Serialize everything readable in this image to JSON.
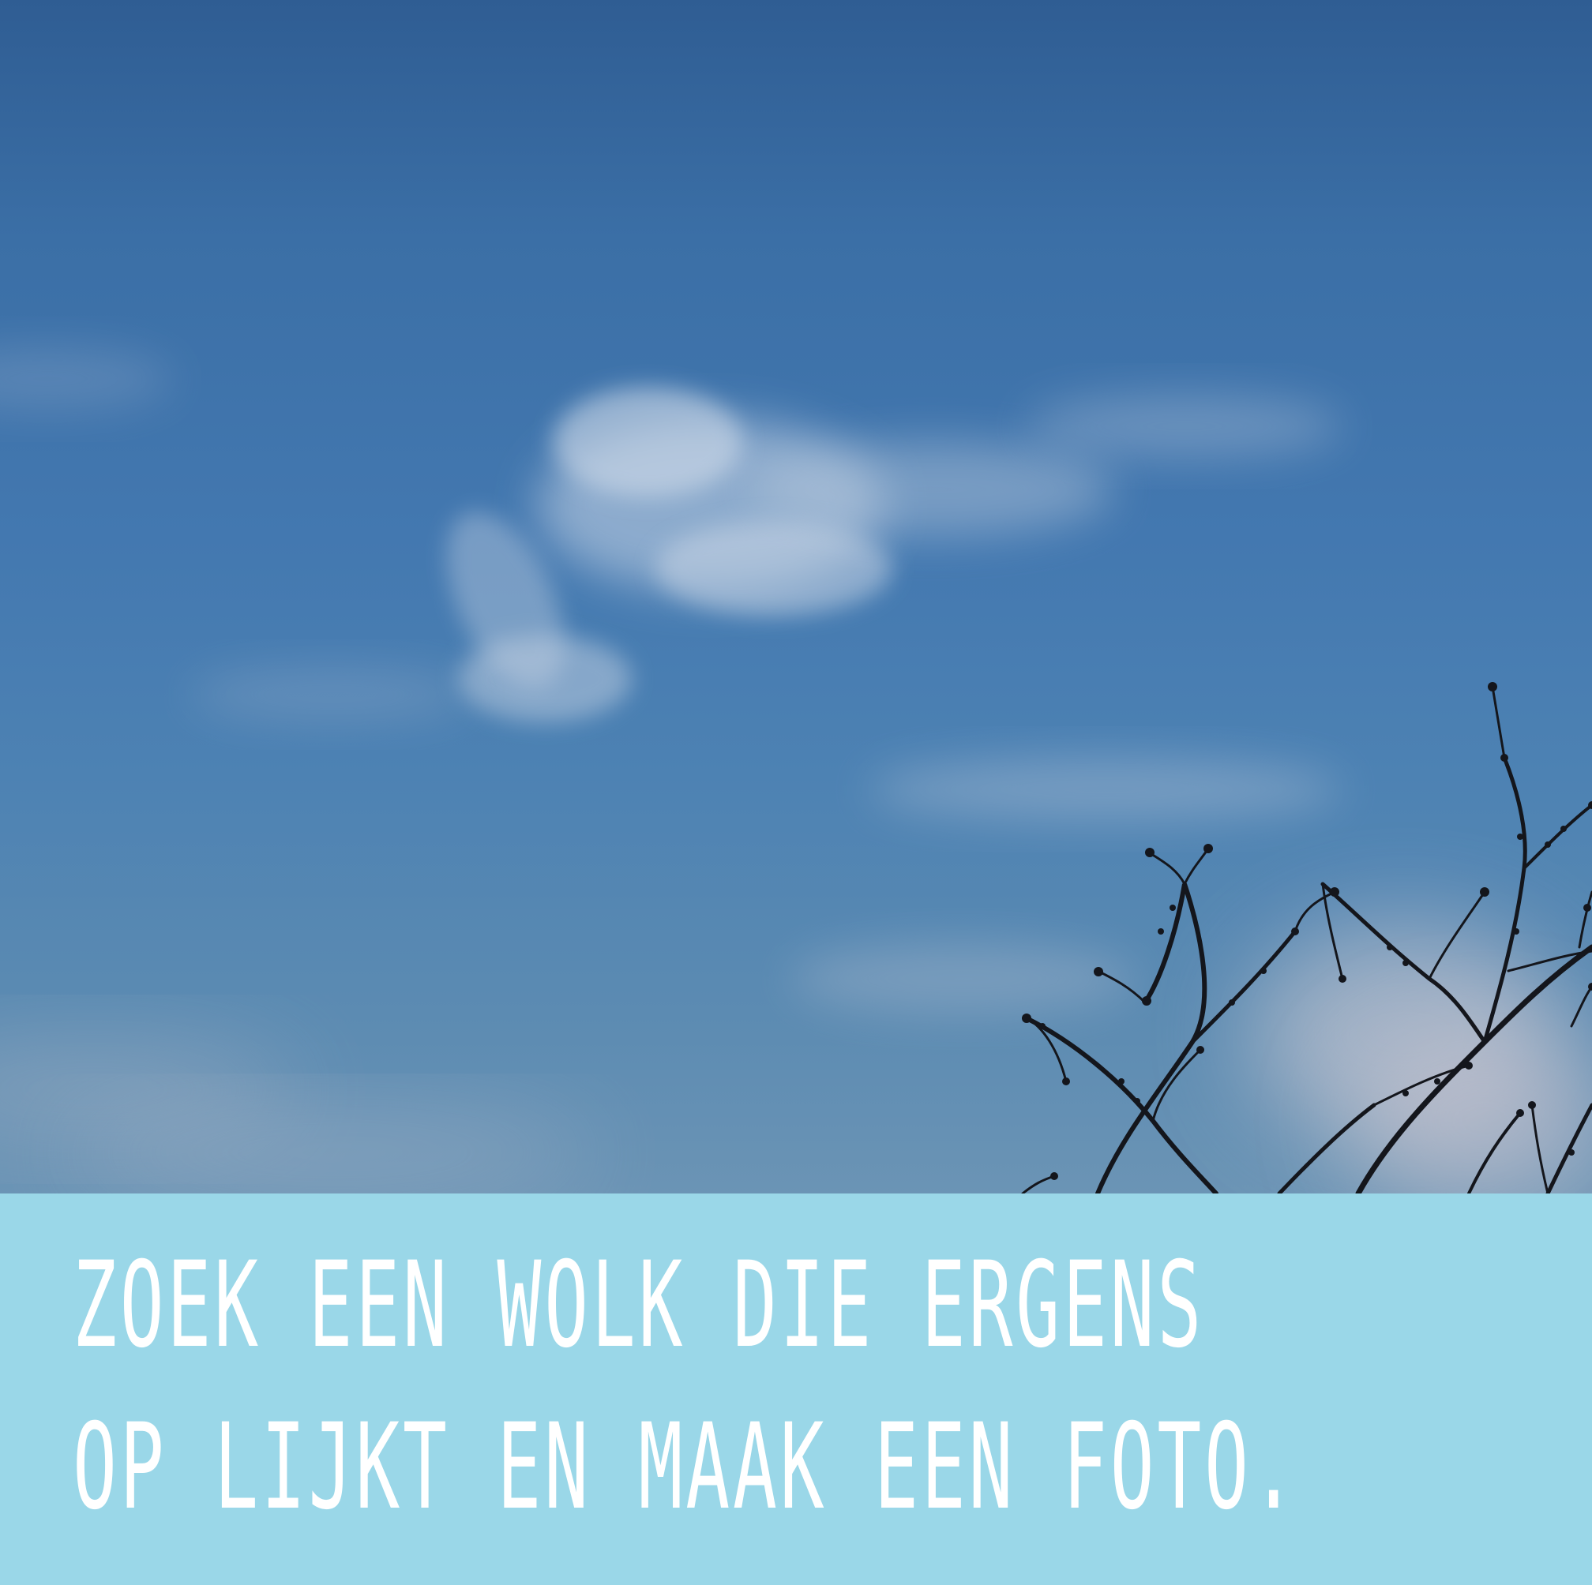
{
  "caption": {
    "line1": "ZOEK EEN WOLK DIE ERGENS",
    "line2": "OP LIJKT EN MAAK EEN FOTO."
  },
  "colors": {
    "sky_top": "#2f5d93",
    "sky_bottom": "#6b94b5",
    "banner": "#9ad7e8",
    "caption_text": "#ffffff",
    "branches": "#14161c"
  }
}
